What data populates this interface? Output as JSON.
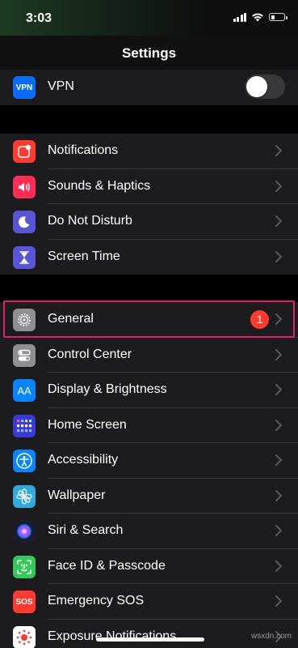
{
  "status_bar": {
    "time": "3:03"
  },
  "nav": {
    "title": "Settings"
  },
  "groups": [
    {
      "items": [
        {
          "label": "VPN",
          "icon": "vpn-icon",
          "icon_text": "VPN",
          "icon_color": "#0a6cff",
          "toggle": "off"
        }
      ]
    },
    {
      "items": [
        {
          "label": "Notifications",
          "icon": "notifications-icon",
          "icon_color": "#ff3b30"
        },
        {
          "label": "Sounds & Haptics",
          "icon": "speaker-icon",
          "icon_color": "#ff2d55"
        },
        {
          "label": "Do Not Disturb",
          "icon": "moon-icon",
          "icon_color": "#5856d6"
        },
        {
          "label": "Screen Time",
          "icon": "hourglass-icon",
          "icon_color": "#5856d6"
        }
      ]
    },
    {
      "items": [
        {
          "label": "General",
          "icon": "gear-icon",
          "icon_color": "#8e8e93",
          "badge": "1",
          "highlighted": true
        },
        {
          "label": "Control Center",
          "icon": "toggles-icon",
          "icon_color": "#8e8e93"
        },
        {
          "label": "Display & Brightness",
          "icon": "text-size-icon",
          "icon_text": "AA",
          "icon_color": "#0a84ff"
        },
        {
          "label": "Home Screen",
          "icon": "app-grid-icon",
          "icon_color": "#3a3ad6"
        },
        {
          "label": "Accessibility",
          "icon": "accessibility-icon",
          "icon_color": "#0a84ff"
        },
        {
          "label": "Wallpaper",
          "icon": "flower-icon",
          "icon_color": "#34aadc"
        },
        {
          "label": "Siri & Search",
          "icon": "siri-icon",
          "icon_color": "#1c1c2e"
        },
        {
          "label": "Face ID & Passcode",
          "icon": "face-id-icon",
          "icon_color": "#34c759"
        },
        {
          "label": "Emergency SOS",
          "icon": "sos-icon",
          "icon_text": "SOS",
          "icon_color": "#ff3b30"
        },
        {
          "label": "Exposure Notifications",
          "icon": "exposure-icon",
          "icon_color": "#ffffff"
        }
      ]
    }
  ],
  "highlight_color": "#e0206b",
  "watermark": "wsxdn.com"
}
